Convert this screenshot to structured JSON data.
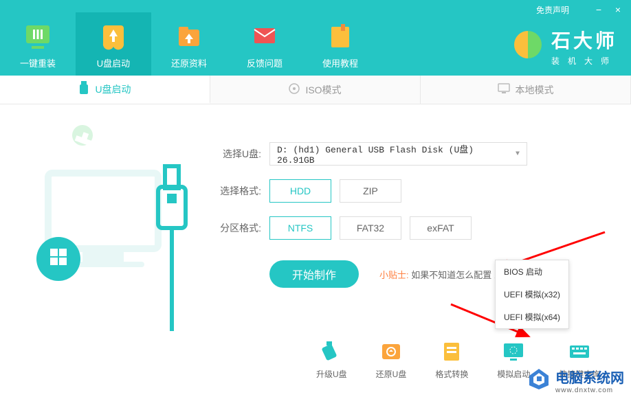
{
  "header": {
    "disclaimer": "免责声明",
    "navTabs": [
      {
        "label": "一键重装",
        "active": false
      },
      {
        "label": "U盘启动",
        "active": true
      },
      {
        "label": "还原资料",
        "active": false
      },
      {
        "label": "反馈问题",
        "active": false
      },
      {
        "label": "使用教程",
        "active": false
      }
    ],
    "brandTitle": "石大师",
    "brandSub": "装机大师"
  },
  "modeTabs": [
    {
      "label": "U盘启动",
      "active": true
    },
    {
      "label": "ISO模式",
      "active": false
    },
    {
      "label": "本地模式",
      "active": false
    }
  ],
  "form": {
    "diskLabel": "选择U盘:",
    "diskValue": "D: (hd1) General USB Flash Disk  (U盘) 26.91GB",
    "formatLabel": "选择格式:",
    "formatOptions": [
      {
        "label": "HDD",
        "selected": true
      },
      {
        "label": "ZIP",
        "selected": false
      }
    ],
    "fsLabel": "分区格式:",
    "fsOptions": [
      {
        "label": "NTFS",
        "selected": true
      },
      {
        "label": "FAT32",
        "selected": false
      },
      {
        "label": "exFAT",
        "selected": false
      }
    ],
    "startBtn": "开始制作",
    "hintLabel": "小贴士:",
    "hintText": "如果不知道怎么配置                即可"
  },
  "bottomTools": [
    {
      "label": "升级U盘"
    },
    {
      "label": "还原U盘"
    },
    {
      "label": "格式转换"
    },
    {
      "label": "模拟启动"
    },
    {
      "label": "快捷键查询"
    }
  ],
  "contextMenu": [
    {
      "label": "BIOS 启动"
    },
    {
      "label": "UEFI 模拟(x32)"
    },
    {
      "label": "UEFI 模拟(x64)"
    }
  ],
  "watermark": {
    "title": "电脑系统网",
    "sub": "www.dnxtw.com"
  }
}
